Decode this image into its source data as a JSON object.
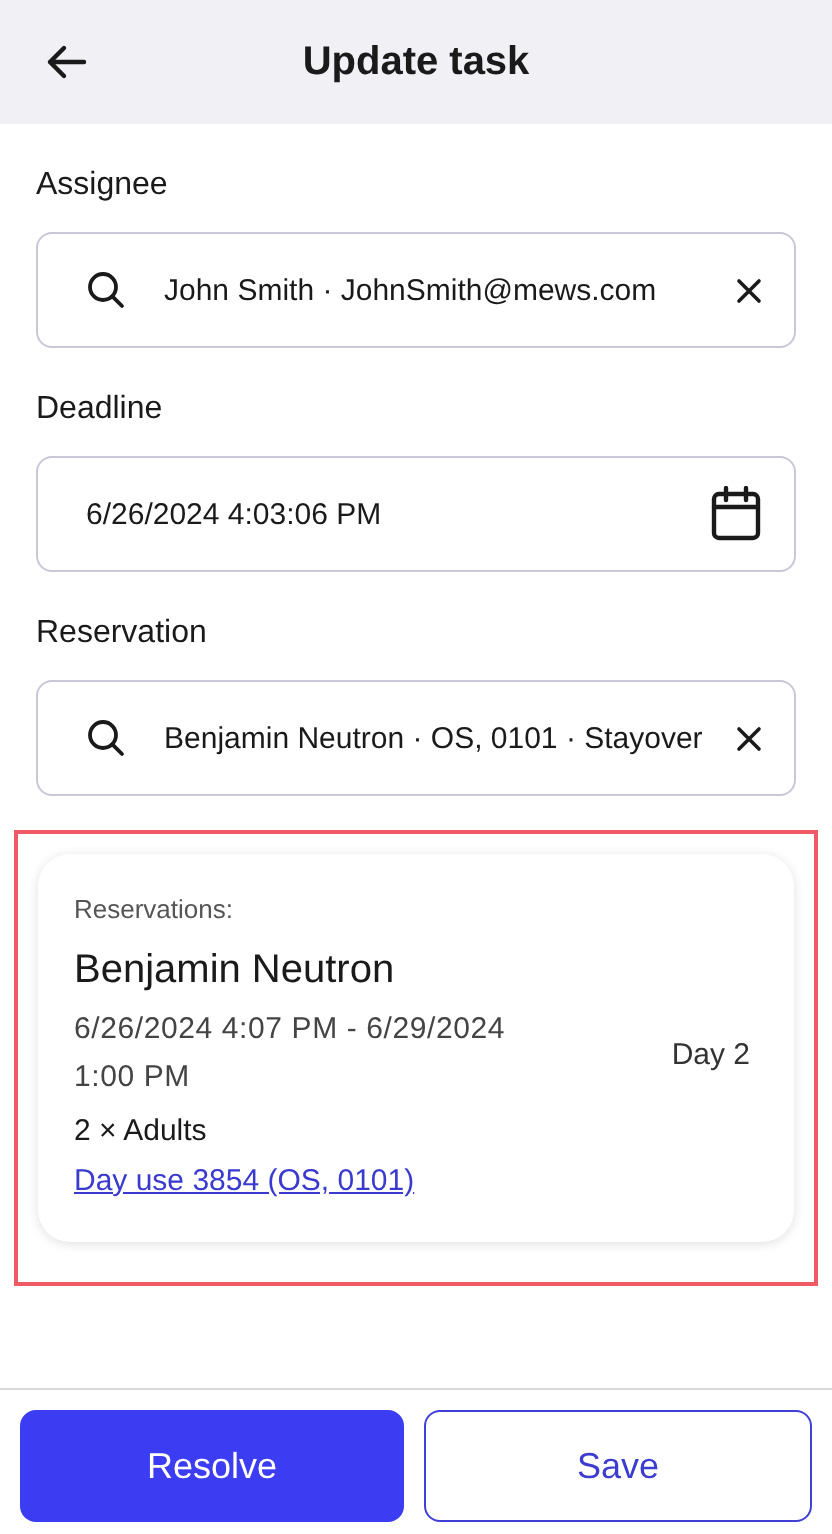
{
  "header": {
    "title": "Update task"
  },
  "fields": [
    {
      "label": "Assignee",
      "kind": "search",
      "value": "John Smith · JohnSmith@mews.com",
      "clearable": true
    },
    {
      "label": "Deadline",
      "kind": "date",
      "value": "6/26/2024 4:03:06 PM",
      "clearable": false
    },
    {
      "label": "Reservation",
      "kind": "search",
      "value": "Benjamin Neutron · OS, 0101 · Stayover",
      "clearable": true
    }
  ],
  "reservation_card": {
    "highlighted": true,
    "heading": "Reservations:",
    "guest": "Benjamin Neutron",
    "dates": "6/26/2024 4:07 PM - 6/29/2024 1:00 PM",
    "day": "Day 2",
    "guests": "2 × Adults",
    "link": "Day use 3854 (OS, 0101)"
  },
  "buttons": [
    {
      "label": "Resolve",
      "kind": "primary"
    },
    {
      "label": "Save",
      "kind": "secondary"
    }
  ]
}
